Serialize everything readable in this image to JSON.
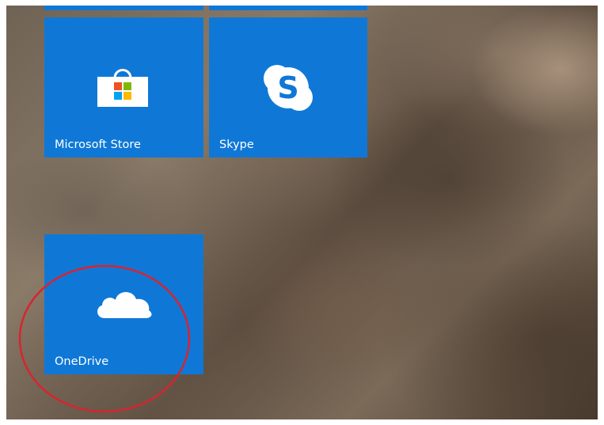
{
  "tiles": {
    "store": {
      "label": "Microsoft Store",
      "icon": "store-bag-icon"
    },
    "skype": {
      "label": "Skype",
      "icon": "skype-icon"
    },
    "onedrive": {
      "label": "OneDrive",
      "icon": "cloud-icon"
    }
  },
  "colors": {
    "tile_blue": "#0f78d7",
    "annotation_red": "#d8242f"
  }
}
